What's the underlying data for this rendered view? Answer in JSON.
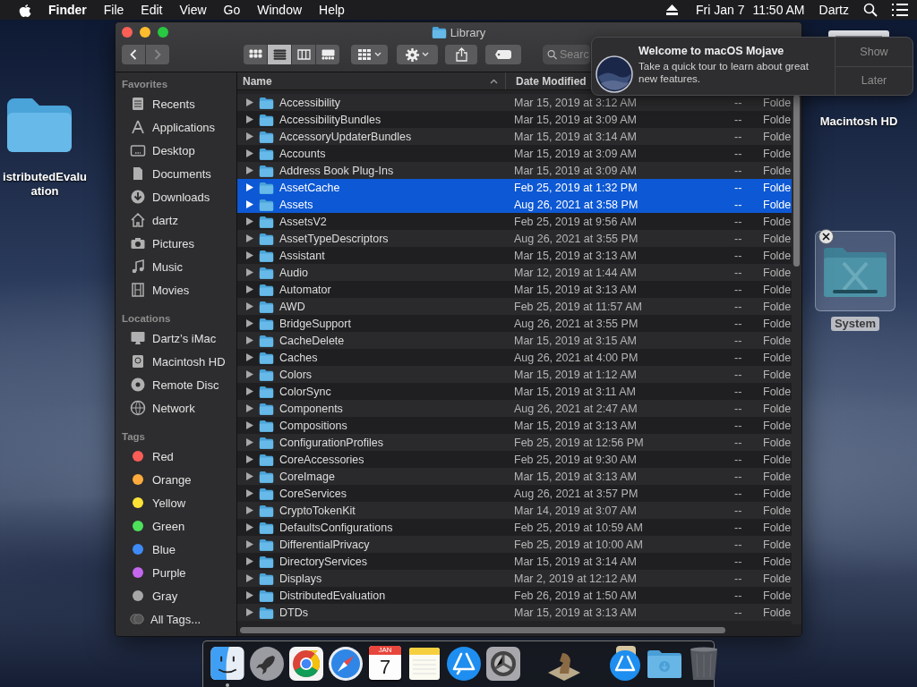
{
  "menu_bar": {
    "app_name": "Finder",
    "menus": [
      "File",
      "Edit",
      "View",
      "Go",
      "Window",
      "Help"
    ],
    "date": "Fri Jan 7",
    "time": "11:50 AM",
    "user": "Dartz"
  },
  "desktop_icons": [
    {
      "kind": "folder",
      "label_lines": [
        "istributedEvalu",
        "ation"
      ]
    },
    {
      "kind": "drive",
      "label_lines": [
        "Macintosh HD"
      ]
    },
    {
      "kind": "system",
      "label_lines": [
        "System"
      ]
    }
  ],
  "window": {
    "title": "Library",
    "views": [
      {
        "selected": false
      },
      {
        "selected": true
      },
      {
        "selected": false
      },
      {
        "selected": false
      }
    ],
    "search": {
      "placeholder": "Searc"
    },
    "sidebar": [
      {
        "heading": "Favorites",
        "items": [
          {
            "label": "Recents"
          },
          {
            "label": "Applications"
          },
          {
            "label": "Desktop"
          },
          {
            "label": "Documents"
          },
          {
            "label": "Downloads"
          },
          {
            "label": "dartz"
          },
          {
            "label": "Pictures"
          },
          {
            "label": "Music"
          },
          {
            "label": "Movies"
          }
        ]
      },
      {
        "heading": "Locations",
        "items": [
          {
            "label": "Dartz’s iMac"
          },
          {
            "label": "Macintosh HD"
          },
          {
            "label": "Remote Disc"
          },
          {
            "label": "Network"
          }
        ]
      },
      {
        "heading": "Tags",
        "items": [
          {
            "kind": "tag",
            "label": "Red",
            "color": "#fc5c57"
          },
          {
            "kind": "tag",
            "label": "Orange",
            "color": "#fdab3c"
          },
          {
            "kind": "tag",
            "label": "Yellow",
            "color": "#fee337"
          },
          {
            "kind": "tag",
            "label": "Green",
            "color": "#4ee15b"
          },
          {
            "kind": "tag",
            "label": "Blue",
            "color": "#3e8bf7"
          },
          {
            "kind": "tag",
            "label": "Purple",
            "color": "#c567ee"
          },
          {
            "kind": "tag",
            "label": "Gray",
            "color": "#a7a7a7"
          },
          {
            "kind": "all",
            "label": "All Tags..."
          }
        ]
      }
    ],
    "columns": [
      "Name",
      "Date Modified"
    ],
    "rows": [
      {
        "name": "Accessibility",
        "date_modified": "Mar 15, 2019 at 3:12 AM",
        "column_3": "--",
        "column_4": "Folde",
        "selected": false
      },
      {
        "name": "AccessibilityBundles",
        "date_modified": "Mar 15, 2019 at 3:09 AM",
        "column_3": "--",
        "column_4": "Folde",
        "selected": false
      },
      {
        "name": "AccessoryUpdaterBundles",
        "date_modified": "Mar 15, 2019 at 3:14 AM",
        "column_3": "--",
        "column_4": "Folde",
        "selected": false
      },
      {
        "name": "Accounts",
        "date_modified": "Mar 15, 2019 at 3:09 AM",
        "column_3": "--",
        "column_4": "Folde",
        "selected": false
      },
      {
        "name": "Address Book Plug-Ins",
        "date_modified": "Mar 15, 2019 at 3:09 AM",
        "column_3": "--",
        "column_4": "Folde",
        "selected": false
      },
      {
        "name": "AssetCache",
        "date_modified": "Feb 25, 2019 at 1:32 PM",
        "column_3": "--",
        "column_4": "Folde",
        "selected": true
      },
      {
        "name": "Assets",
        "date_modified": "Aug 26, 2021 at 3:58 PM",
        "column_3": "--",
        "column_4": "Folde",
        "selected": true
      },
      {
        "name": "AssetsV2",
        "date_modified": "Feb 25, 2019 at 9:56 AM",
        "column_3": "--",
        "column_4": "Folde",
        "selected": false
      },
      {
        "name": "AssetTypeDescriptors",
        "date_modified": "Aug 26, 2021 at 3:55 PM",
        "column_3": "--",
        "column_4": "Folde",
        "selected": false
      },
      {
        "name": "Assistant",
        "date_modified": "Mar 15, 2019 at 3:13 AM",
        "column_3": "--",
        "column_4": "Folde",
        "selected": false
      },
      {
        "name": "Audio",
        "date_modified": "Mar 12, 2019 at 1:44 AM",
        "column_3": "--",
        "column_4": "Folde",
        "selected": false
      },
      {
        "name": "Automator",
        "date_modified": "Mar 15, 2019 at 3:13 AM",
        "column_3": "--",
        "column_4": "Folde",
        "selected": false
      },
      {
        "name": "AWD",
        "date_modified": "Feb 25, 2019 at 11:57 AM",
        "column_3": "--",
        "column_4": "Folde",
        "selected": false
      },
      {
        "name": "BridgeSupport",
        "date_modified": "Aug 26, 2021 at 3:55 PM",
        "column_3": "--",
        "column_4": "Folde",
        "selected": false
      },
      {
        "name": "CacheDelete",
        "date_modified": "Mar 15, 2019 at 3:15 AM",
        "column_3": "--",
        "column_4": "Folde",
        "selected": false
      },
      {
        "name": "Caches",
        "date_modified": "Aug 26, 2021 at 4:00 PM",
        "column_3": "--",
        "column_4": "Folde",
        "selected": false
      },
      {
        "name": "Colors",
        "date_modified": "Mar 15, 2019 at 1:12 AM",
        "column_3": "--",
        "column_4": "Folde",
        "selected": false
      },
      {
        "name": "ColorSync",
        "date_modified": "Mar 15, 2019 at 3:11 AM",
        "column_3": "--",
        "column_4": "Folde",
        "selected": false
      },
      {
        "name": "Components",
        "date_modified": "Aug 26, 2021 at 2:47 AM",
        "column_3": "--",
        "column_4": "Folde",
        "selected": false
      },
      {
        "name": "Compositions",
        "date_modified": "Mar 15, 2019 at 3:13 AM",
        "column_3": "--",
        "column_4": "Folde",
        "selected": false
      },
      {
        "name": "ConfigurationProfiles",
        "date_modified": "Feb 25, 2019 at 12:56 PM",
        "column_3": "--",
        "column_4": "Folde",
        "selected": false
      },
      {
        "name": "CoreAccessories",
        "date_modified": "Feb 25, 2019 at 9:30 AM",
        "column_3": "--",
        "column_4": "Folde",
        "selected": false
      },
      {
        "name": "CoreImage",
        "date_modified": "Mar 15, 2019 at 3:13 AM",
        "column_3": "--",
        "column_4": "Folde",
        "selected": false
      },
      {
        "name": "CoreServices",
        "date_modified": "Aug 26, 2021 at 3:57 PM",
        "column_3": "--",
        "column_4": "Folde",
        "selected": false
      },
      {
        "name": "CryptoTokenKit",
        "date_modified": "Mar 14, 2019 at 3:07 AM",
        "column_3": "--",
        "column_4": "Folde",
        "selected": false
      },
      {
        "name": "DefaultsConfigurations",
        "date_modified": "Feb 25, 2019 at 10:59 AM",
        "column_3": "--",
        "column_4": "Folde",
        "selected": false
      },
      {
        "name": "DifferentialPrivacy",
        "date_modified": "Feb 25, 2019 at 10:00 AM",
        "column_3": "--",
        "column_4": "Folde",
        "selected": false
      },
      {
        "name": "DirectoryServices",
        "date_modified": "Mar 15, 2019 at 3:14 AM",
        "column_3": "--",
        "column_4": "Folde",
        "selected": false
      },
      {
        "name": "Displays",
        "date_modified": "Mar 2, 2019 at 12:12 AM",
        "column_3": "--",
        "column_4": "Folde",
        "selected": false
      },
      {
        "name": "DistributedEvaluation",
        "date_modified": "Feb 26, 2019 at 1:50 AM",
        "column_3": "--",
        "column_4": "Folde",
        "selected": false
      },
      {
        "name": "DTDs",
        "date_modified": "Mar 15, 2019 at 3:13 AM",
        "column_3": "--",
        "column_4": "Folde",
        "selected": false
      }
    ]
  },
  "notification": {
    "title": "Welcome to macOS Mojave",
    "body": "Take a quick tour to learn about great new features.",
    "buttons": [
      "Show",
      "Later"
    ]
  },
  "dock": {
    "groups": [
      {
        "items": [
          {
            "kind": "finder",
            "running": true
          },
          {
            "kind": "launchpad",
            "running": false
          },
          {
            "kind": "chrome",
            "running": false
          },
          {
            "kind": "safari",
            "running": false
          },
          {
            "kind": "calendar",
            "month": "JAN",
            "day": "7",
            "running": false
          },
          {
            "kind": "notes",
            "running": false
          },
          {
            "kind": "app_store",
            "running": false
          },
          {
            "kind": "system_preferences",
            "running": false
          }
        ]
      },
      {
        "items": [
          {
            "kind": "chess",
            "running": false
          }
        ]
      },
      {
        "items": [
          {
            "kind": "app_store_download",
            "running": false
          },
          {
            "kind": "downloads",
            "running": false
          },
          {
            "kind": "trash",
            "running": false
          }
        ]
      }
    ]
  }
}
